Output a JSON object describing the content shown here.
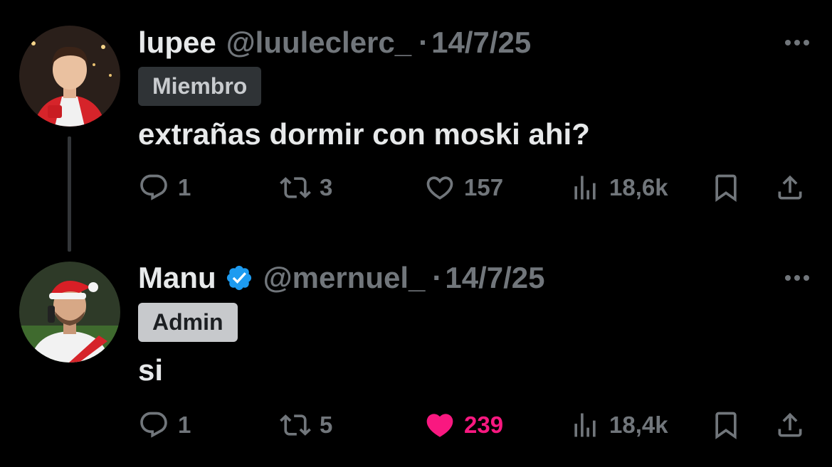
{
  "tweets": [
    {
      "author_name": "lupee",
      "handle": "@luuleclerc_",
      "separator": "·",
      "date": "14/7/25",
      "badge": "Miembro",
      "verified": false,
      "text": "extrañas dormir con moski ahi?",
      "replies": "1",
      "retweets": "3",
      "likes": "157",
      "liked": false,
      "views": "18,6k"
    },
    {
      "author_name": "Manu",
      "handle": "@mernuel_",
      "separator": "·",
      "date": "14/7/25",
      "badge": "Admin",
      "verified": true,
      "text": "si",
      "replies": "1",
      "retweets": "5",
      "likes": "239",
      "liked": true,
      "views": "18,4k"
    }
  ],
  "colors": {
    "background": "#000000",
    "text": "#e7e9ea",
    "muted": "#71767b",
    "like_active": "#f91880",
    "verified": "#1d9bf0"
  },
  "icons": {
    "reply": "speech-bubble-icon",
    "retweet": "retweet-arrows-icon",
    "like": "heart-icon",
    "views": "bar-chart-icon",
    "bookmark": "bookmark-icon",
    "share": "share-upload-icon",
    "more": "ellipsis-icon",
    "verified": "verified-badge-icon"
  }
}
